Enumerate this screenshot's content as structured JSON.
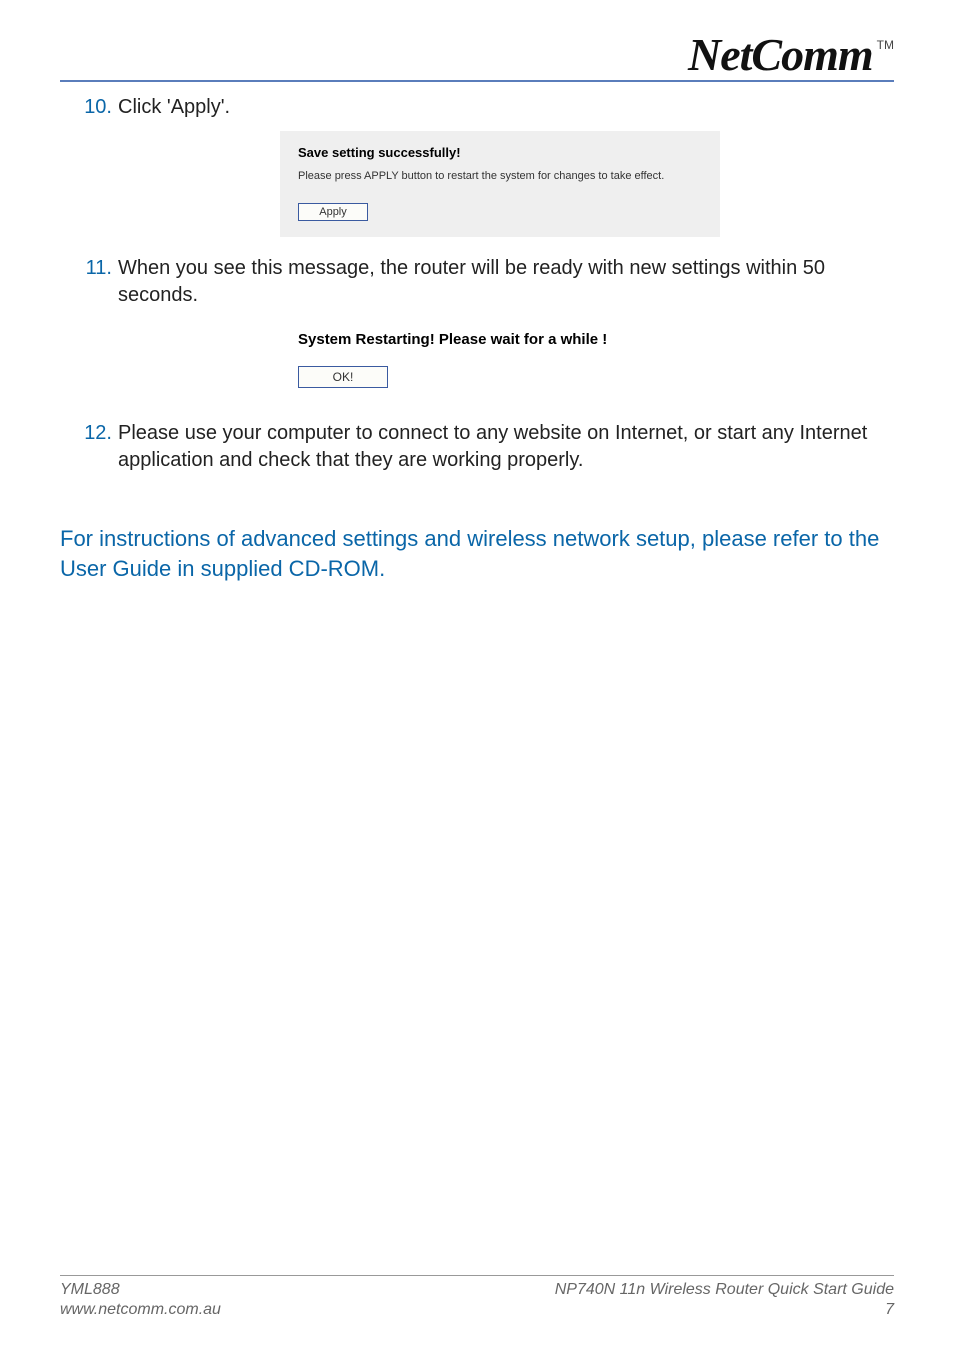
{
  "brand": {
    "name": "NetComm",
    "tm": "TM"
  },
  "steps": {
    "s10": {
      "num": "10.",
      "text": "Click 'Apply'."
    },
    "s11": {
      "num": "11.",
      "text": "When you see this message, the router will be ready with new settings within 50 seconds."
    },
    "s12": {
      "num": "12.",
      "text": "Please use your computer to connect to any website on Internet, or start any Internet application and check that they are working properly."
    }
  },
  "dialog1": {
    "title": "Save setting successfully!",
    "msg": "Please press APPLY button to restart the system for changes to take effect.",
    "button": "Apply"
  },
  "dialog2": {
    "title": "System Restarting! Please wait for a while !",
    "button": "OK!"
  },
  "note": "For instructions of advanced settings and wireless network setup, please refer to the User Guide in supplied CD-ROM.",
  "footer": {
    "left1": "YML888",
    "left2": "www.netcomm.com.au",
    "right1": "NP740N 11n Wireless Router Quick Start Guide",
    "right2": "7"
  }
}
